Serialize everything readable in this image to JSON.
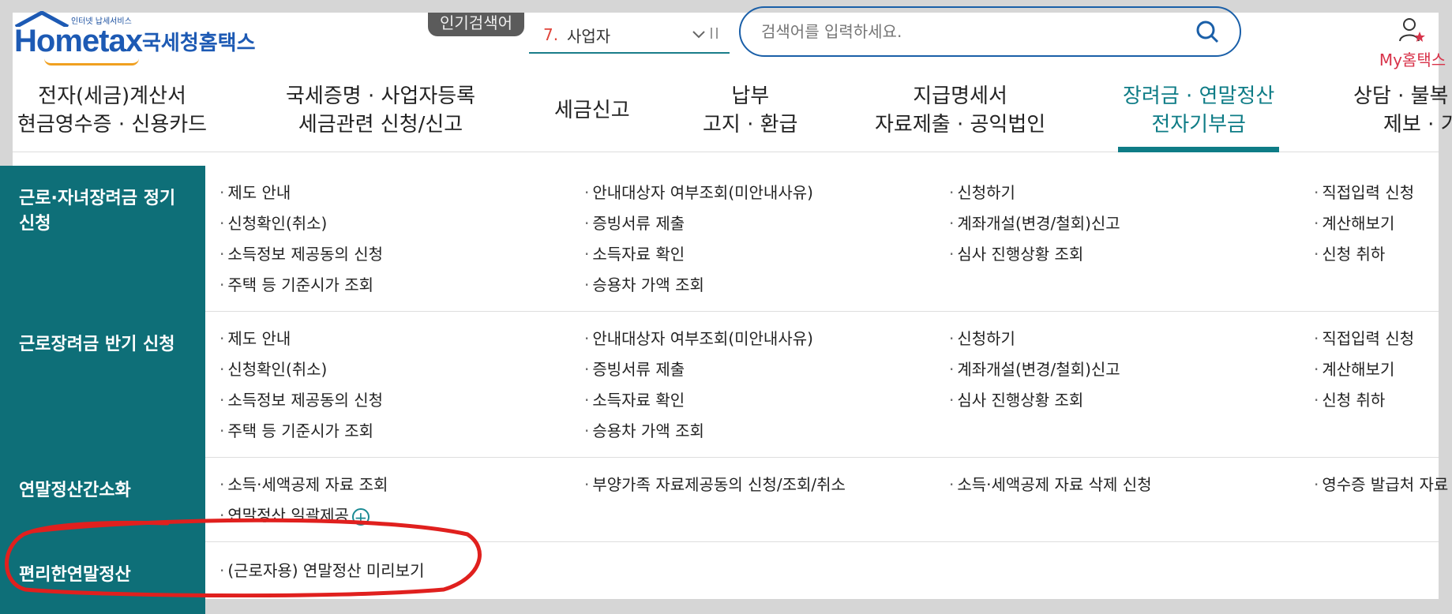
{
  "header": {
    "logo_tagline": "인터넷 납세서비스",
    "logo_brand": "Hometax",
    "logo_korean": "국세청홈택스",
    "popular_label": "인기검색어",
    "ranking_number": "7.",
    "ranking_word": "사업자",
    "search_placeholder": "검색어를 입력하세요.",
    "my_label": "My홈택스"
  },
  "nav": [
    {
      "line1": "전자(세금)계산서",
      "line2": "현금영수증 · 신용카드"
    },
    {
      "line1": "국세증명 · 사업자등록",
      "line2": "세금관련 신청/신고"
    },
    {
      "line1": "세금신고",
      "line2": ""
    },
    {
      "line1": "납부",
      "line2": "고지 · 환급"
    },
    {
      "line1": "지급명세서",
      "line2": "자료제출 · 공익법인"
    },
    {
      "line1": "장려금 · 연말정산",
      "line2": "전자기부금"
    },
    {
      "line1": "상담 · 불복",
      "line2": "제보 · 기"
    }
  ],
  "sections": [
    {
      "category": "근로·자녀장려금 정기 신청",
      "links": [
        "제도 안내",
        "안내대상자 여부조회(미안내사유)",
        "신청하기",
        "직접입력 신청",
        "신청확인(취소)",
        "증빙서류 제출",
        "계좌개설(변경/철회)신고",
        "계산해보기",
        "소득정보 제공동의 신청",
        "소득자료 확인",
        "심사 진행상황 조회",
        "신청 취하",
        "주택 등 기준시가 조회",
        "승용차 가액 조회"
      ]
    },
    {
      "category": "근로장려금 반기 신청",
      "links": [
        "제도 안내",
        "안내대상자 여부조회(미안내사유)",
        "신청하기",
        "직접입력 신청",
        "신청확인(취소)",
        "증빙서류 제출",
        "계좌개설(변경/철회)신고",
        "계산해보기",
        "소득정보 제공동의 신청",
        "소득자료 확인",
        "심사 진행상황 조회",
        "신청 취하",
        "주택 등 기준시가 조회",
        "승용차 가액 조회"
      ]
    },
    {
      "category": "연말정산간소화",
      "links": [
        "소득·세액공제 자료 조회",
        "부양가족 자료제공동의 신청/조회/취소",
        "소득·세액공제 자료 삭제 신청",
        "영수증 발급처 자료",
        "연말정산 일괄제공"
      ]
    },
    {
      "category": "편리한연말정산",
      "links": [
        "(근로자용) 연말정산 미리보기"
      ]
    }
  ],
  "colors": {
    "accent": "#0e7c86",
    "category_bg": "#0e6f78",
    "annotation_red": "#e0201e"
  }
}
